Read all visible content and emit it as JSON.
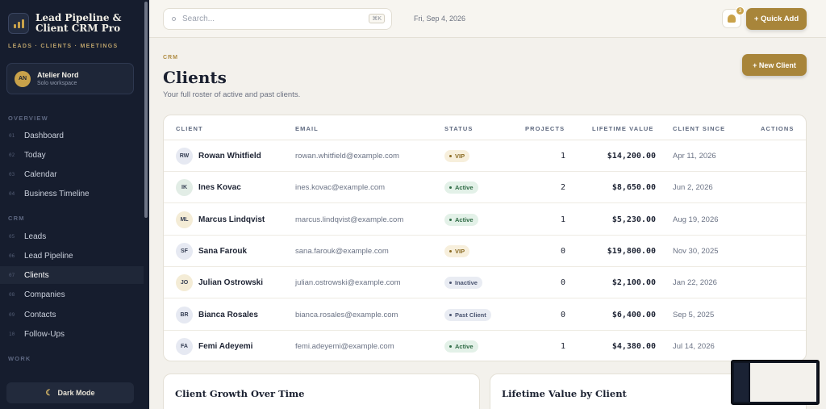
{
  "app": {
    "title": "Lead Pipeline & Client CRM Pro",
    "subtitle": "LEADS · CLIENTS · MEETINGS"
  },
  "workspace": {
    "initials": "AN",
    "name": "Atelier Nord",
    "type": "Solo workspace"
  },
  "sidebar": {
    "sections": [
      {
        "label": "OVERVIEW",
        "items": [
          {
            "num": "01",
            "label": "Dashboard"
          },
          {
            "num": "02",
            "label": "Today"
          },
          {
            "num": "03",
            "label": "Calendar"
          },
          {
            "num": "04",
            "label": "Business Timeline"
          }
        ]
      },
      {
        "label": "CRM",
        "items": [
          {
            "num": "05",
            "label": "Leads"
          },
          {
            "num": "06",
            "label": "Lead Pipeline"
          },
          {
            "num": "07",
            "label": "Clients",
            "active": true
          },
          {
            "num": "08",
            "label": "Companies"
          },
          {
            "num": "09",
            "label": "Contacts"
          },
          {
            "num": "10",
            "label": "Follow-Ups"
          }
        ]
      },
      {
        "label": "WORK",
        "items": []
      }
    ],
    "dark_mode_label": "Dark Mode"
  },
  "topbar": {
    "search_placeholder": "Search...",
    "shortcut": "⌘K",
    "date": "Fri, Sep 4, 2026",
    "notifications": "3",
    "quick_add": "+ Quick Add"
  },
  "page": {
    "eyebrow": "CRM",
    "title": "Clients",
    "subtitle": "Your full roster of active and past clients.",
    "new_client": "+ New Client"
  },
  "table": {
    "headers": [
      "CLIENT",
      "EMAIL",
      "STATUS",
      "PROJECTS",
      "LIFETIME VALUE",
      "CLIENT SINCE",
      "ACTIONS"
    ],
    "rows": [
      {
        "initials": "RW",
        "name": "Rowan Whitfield",
        "email": "rowan.whitfield@example.com",
        "status": "VIP",
        "projects": "1",
        "ltv": "$14,200.00",
        "since": "Apr 11, 2026"
      },
      {
        "initials": "IK",
        "name": "Ines Kovac",
        "email": "ines.kovac@example.com",
        "status": "Active",
        "projects": "2",
        "ltv": "$8,650.00",
        "since": "Jun 2, 2026"
      },
      {
        "initials": "ML",
        "name": "Marcus Lindqvist",
        "email": "marcus.lindqvist@example.com",
        "status": "Active",
        "projects": "1",
        "ltv": "$5,230.00",
        "since": "Aug 19, 2026"
      },
      {
        "initials": "SF",
        "name": "Sana Farouk",
        "email": "sana.farouk@example.com",
        "status": "VIP",
        "projects": "0",
        "ltv": "$19,800.00",
        "since": "Nov 30, 2025"
      },
      {
        "initials": "JO",
        "name": "Julian Ostrowski",
        "email": "julian.ostrowski@example.com",
        "status": "Inactive",
        "projects": "0",
        "ltv": "$2,100.00",
        "since": "Jan 22, 2026"
      },
      {
        "initials": "BR",
        "name": "Bianca Rosales",
        "email": "bianca.rosales@example.com",
        "status": "Past Client",
        "projects": "0",
        "ltv": "$6,400.00",
        "since": "Sep 5, 2025"
      },
      {
        "initials": "FA",
        "name": "Femi Adeyemi",
        "email": "femi.adeyemi@example.com",
        "status": "Active",
        "projects": "1",
        "ltv": "$4,380.00",
        "since": "Jul 14, 2026"
      }
    ]
  },
  "cards": [
    {
      "title": "Client Growth Over Time"
    },
    {
      "title": "Lifetime Value by Client"
    }
  ],
  "colors": {
    "accent": "#a8853a",
    "sidebar_bg": "#161d2e",
    "status_vip_bg": "#f7efdc",
    "status_vip_fg": "#8a6a22",
    "status_active_bg": "#e3f1e8",
    "status_active_fg": "#2f6b45",
    "status_inactive_bg": "#e9ecf3",
    "status_inactive_fg": "#4a5470",
    "status_past_bg": "#e9ecf3",
    "status_past_fg": "#4a5470"
  },
  "icons": [
    "logo-bars-icon",
    "search-icon",
    "bell-icon",
    "moon-icon"
  ]
}
